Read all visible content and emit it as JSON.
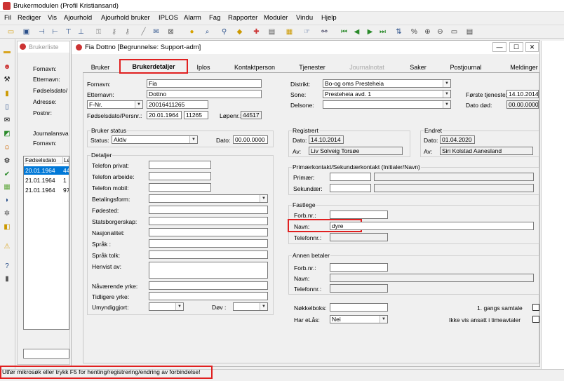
{
  "app": {
    "title": "Brukermodulen (Profil Kristiansand)"
  },
  "menu": [
    "Fil",
    "Rediger",
    "Vis",
    "Ajourhold",
    "Ajourhold bruker",
    "IPLOS",
    "Alarm",
    "Fag",
    "Rapporter",
    "Moduler",
    "Vindu",
    "Hjelp"
  ],
  "list_panel": {
    "title": "Brukerliste",
    "fields": [
      "Fornavn:",
      "Etternavn:",
      "Fødselsdato/",
      "Adresse:",
      "Postnr:"
    ],
    "journal_label": "Journalansva",
    "journal_fornavn": "Fornavn:",
    "columns": [
      "Fødselsdato",
      "Lø"
    ],
    "rows": [
      {
        "date": "20.01.1964",
        "num": "44"
      },
      {
        "date": "21.01.1964",
        "num": "1"
      },
      {
        "date": "21.01.1964",
        "num": "97"
      }
    ]
  },
  "window": {
    "title": "Fia Dottno [Begrunnelse: Support-adm]"
  },
  "tabs": [
    "Bruker",
    "Brukerdetaljer",
    "Iplos",
    "Kontaktperson",
    "Tjenester",
    "Journalnotat",
    "Saker",
    "Postjournal",
    "Meldinger"
  ],
  "form": {
    "fornavn_label": "Fornavn:",
    "fornavn": "Fia",
    "etternavn_label": "Etternavn:",
    "etternavn": "Dottno",
    "idtype": "F-Nr.",
    "idnr": "20016411265",
    "fodsel_label": "Fødselsdato/Persnr.:",
    "fodsel_date": "20.01.1964",
    "persnr": "11265",
    "lopenr_label": "Løpenr.:",
    "lopenr": "44517",
    "distrikt_label": "Distrikt:",
    "distrikt": "Bo-og oms Presteheia",
    "sone_label": "Sone:",
    "sone": "Presteheia avd. 1",
    "delsone_label": "Delsone:",
    "delsone": "",
    "forste_label": "Første tjeneste:",
    "forste": "14.10.2014",
    "dod_label": "Dato død:",
    "dod": "00.00.0000"
  },
  "status": {
    "title": "Bruker status",
    "status_label": "Status:",
    "status": "Aktiv",
    "dato_label": "Dato:",
    "dato": "00.00.0000"
  },
  "detaljer": {
    "title": "Detaljer",
    "fields": [
      "Telefon privat:",
      "Telefon arbeide:",
      "Telefon mobil:",
      "Betalingsform:",
      "Fødested:",
      "Statsborgerskap:",
      "Nasjonalitet:",
      "Språk :",
      "Språk tolk:",
      "Henvist av:",
      "Nåværende yrke:",
      "Tidligere yrke:",
      "Umyndiggjort:"
    ],
    "dov_label": "Døv :"
  },
  "registrert": {
    "title": "Registrert",
    "dato_label": "Dato:",
    "dato": "14.10.2014",
    "av_label": "Av:",
    "av": "Liv Solveig Torsøe"
  },
  "endret": {
    "title": "Endret",
    "dato_label": "Dato:",
    "dato": "01.04.2020",
    "av_label": "Av:",
    "av": "Siri Kolstad Aanesland"
  },
  "primaer": {
    "title": "Primærkontakt/Sekundærkontakt (Initialer/Navn)",
    "primaer_label": "Primær:",
    "sekundaer_label": "Sekundær:"
  },
  "fastlege": {
    "title": "Fastlege",
    "forb_label": "Forb.nr.:",
    "navn_label": "Navn:",
    "navn": "dyre",
    "telefon_label": "Telefonnr.:"
  },
  "annen": {
    "title": "Annen betaler",
    "forb_label": "Forb.nr.:",
    "navn_label": "Navn:",
    "telefon_label": "Telefonnr.:"
  },
  "bottom": {
    "nokkel_label": "Nøkkelboks:",
    "elas_label": "Har eLås:",
    "elas": "Nei",
    "samtale_label": "1. gangs samtale",
    "ikke_label": "Ikke vis ansatt i timeavtaler"
  },
  "statusbar": {
    "text": "Utfør mikrosøk eller trykk F5 for henting/registrering/endring av forbindelse!"
  },
  "colors": {
    "highlight": "#e02020",
    "selection": "#0078d7"
  }
}
